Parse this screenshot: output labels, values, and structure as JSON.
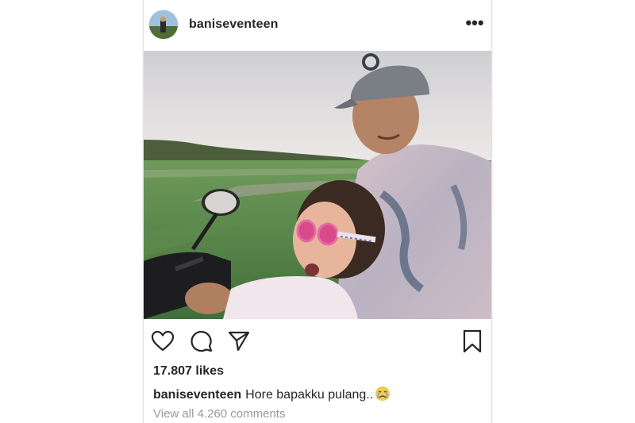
{
  "post": {
    "username": "baniseventeen",
    "more_icon": "more-horizontal-icon",
    "more_label": "•••",
    "actions": {
      "like_icon": "heart-icon",
      "comment_icon": "comment-icon",
      "share_icon": "send-icon",
      "save_icon": "bookmark-icon"
    },
    "likes": "17.807 likes",
    "caption": {
      "user": "baniseventeen",
      "text": "Hore bapakku pulang..",
      "emoji": "😭"
    },
    "view_comments": "View all 4.260 comments"
  },
  "colors": {
    "text": "#262626",
    "muted": "#999999",
    "border": "#e3e3e3"
  }
}
